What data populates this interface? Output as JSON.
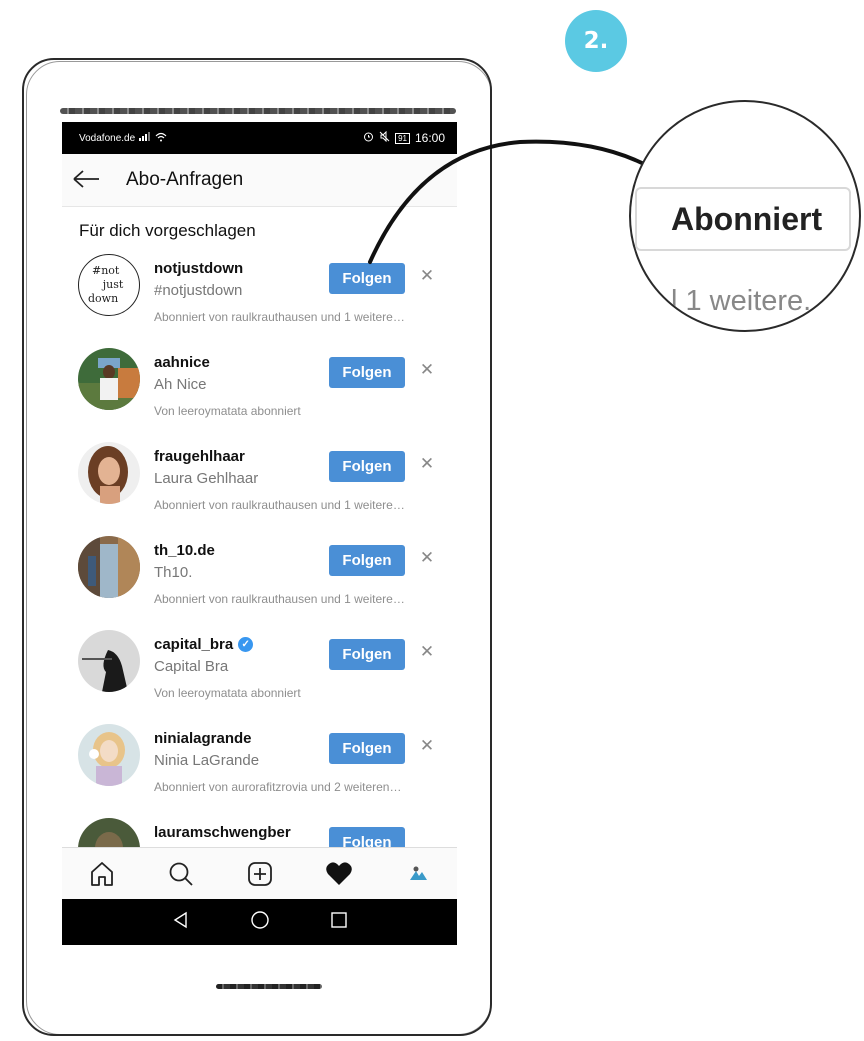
{
  "step": {
    "label": "2."
  },
  "status_bar": {
    "carrier": "Vodafone.de",
    "battery": "91",
    "time": "16:00"
  },
  "header": {
    "title": "Abo-Anfragen"
  },
  "section": {
    "title": "Für dich vorgeschlagen"
  },
  "follow_label": "Folgen",
  "avatar_text": {
    "line1": "#not",
    "line2": "just",
    "line3": "down"
  },
  "suggestions": [
    {
      "username": "notjustdown",
      "name": "#notjustdown",
      "subtitle": "Abonniert von raulkrauthausen und 1 weitere…",
      "avatar": "text-logo",
      "verified": false
    },
    {
      "username": "aahnice",
      "name": "Ah Nice",
      "subtitle": "Von leeroymatata abonniert",
      "avatar": "photo",
      "verified": false
    },
    {
      "username": "fraugehlhaar",
      "name": "Laura Gehlhaar",
      "subtitle": "Abonniert von raulkrauthausen und 1 weitere…",
      "avatar": "photo",
      "verified": false
    },
    {
      "username": "th_10.de",
      "name": "Th10.",
      "subtitle": "Abonniert von raulkrauthausen und 1 weitere…",
      "avatar": "photo",
      "verified": false
    },
    {
      "username": "capital_bra",
      "name": "Capital Bra",
      "subtitle": "Von leeroymatata abonniert",
      "avatar": "photo",
      "verified": true
    },
    {
      "username": "ninialagrande",
      "name": "Ninia LaGrande",
      "subtitle": "Abonniert von aurorafitzrovia und 2 weiteren…",
      "avatar": "photo",
      "verified": false
    },
    {
      "username": "lauramschwengber",
      "name": "",
      "subtitle": "",
      "avatar": "photo",
      "verified": false
    }
  ],
  "bottom_nav": [
    "home-icon",
    "search-icon",
    "add-post-icon",
    "heart-icon",
    "profile-avatar"
  ],
  "android_nav": [
    "back-triangle-icon",
    "home-circle-icon",
    "recents-square-icon"
  ],
  "magnifier": {
    "button_label": "Abonniert",
    "subtitle_fragment": "l 1 weitere."
  },
  "colors": {
    "accent": "#4a8fd6",
    "badge": "#5bc9e3",
    "verified": "#3897f0"
  }
}
